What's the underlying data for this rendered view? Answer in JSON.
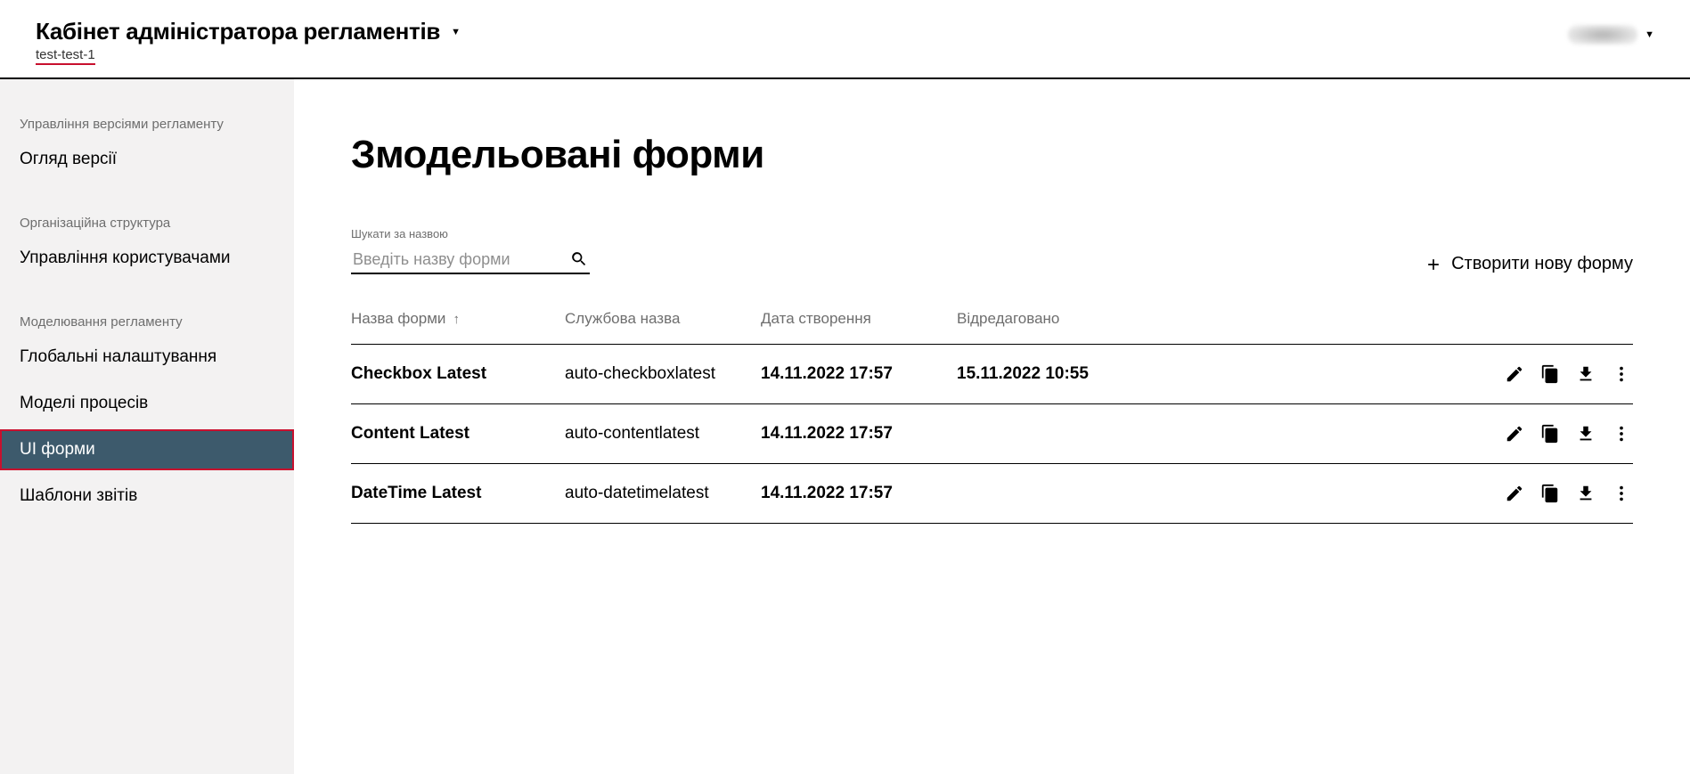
{
  "header": {
    "app_title": "Кабінет адміністратора регламентів",
    "app_subtitle": "test-test-1"
  },
  "sidebar": {
    "section1_label": "Управління версіями регламенту",
    "item_overview": "Огляд версії",
    "section2_label": "Організаційна структура",
    "item_users": "Управління користувачами",
    "section3_label": "Моделювання регламенту",
    "item_global": "Глобальні налаштування",
    "item_processes": "Моделі процесів",
    "item_uiforms": "UI форми",
    "item_templates": "Шаблони звітів"
  },
  "main": {
    "title": "Змодельовані форми",
    "search_label": "Шукати за назвою",
    "search_placeholder": "Введіть назву форми",
    "create_label": "Створити нову форму"
  },
  "table": {
    "head": {
      "name": "Назва форми",
      "svc": "Службова назва",
      "created": "Дата створення",
      "edited": "Відредаговано"
    },
    "rows": [
      {
        "name": "Checkbox Latest",
        "svc": "auto-checkboxlatest",
        "created": "14.11.2022 17:57",
        "edited": "15.11.2022 10:55"
      },
      {
        "name": "Content Latest",
        "svc": "auto-contentlatest",
        "created": "14.11.2022 17:57",
        "edited": ""
      },
      {
        "name": "DateTime Latest",
        "svc": "auto-datetimelatest",
        "created": "14.11.2022 17:57",
        "edited": ""
      }
    ]
  }
}
